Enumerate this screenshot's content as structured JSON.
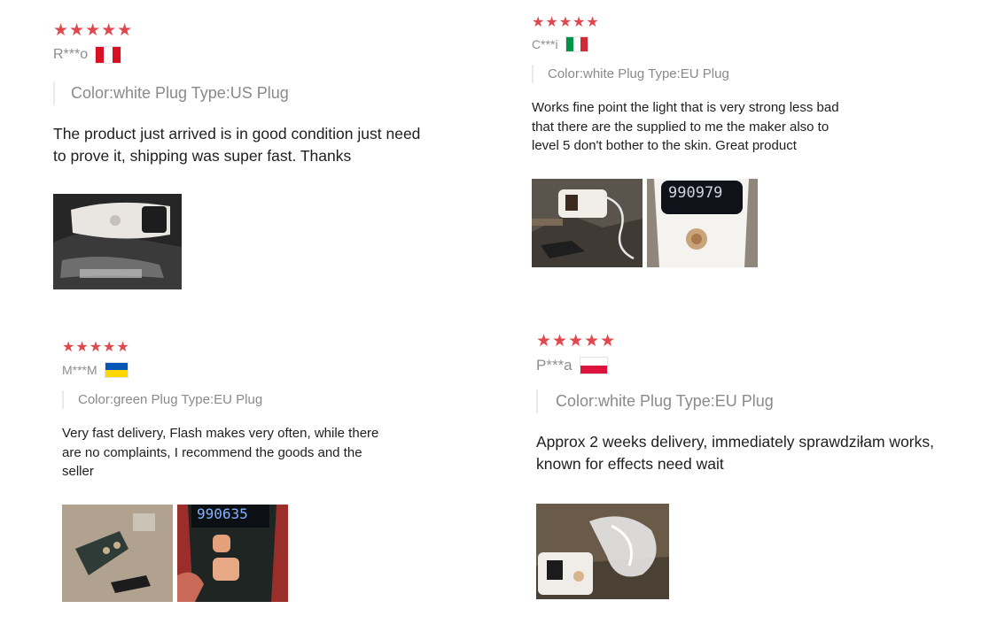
{
  "colors": {
    "star": "#e0484e",
    "muted_text": "#8a8a8a",
    "body_text": "#1e1e1e"
  },
  "reviews": [
    {
      "stars": "★★★★★",
      "reviewer": "R***o",
      "flag": "peru",
      "variant": "Color:white Plug Type:US Plug",
      "text": "The product just arrived is in good condition just need to prove it, shipping was super fast. Thanks",
      "photos": [
        "photo-white-device-in-bag"
      ]
    },
    {
      "stars": "★★★★★",
      "reviewer": "C***i",
      "flag": "italy",
      "variant": "Color:white Plug Type:EU Plug",
      "text": "Works fine point the light that is very strong less bad that there are the supplied to me the maker also to level 5 don't bother to the skin. Great product",
      "photos": [
        "photo-device-with-accessories",
        "photo-device-display"
      ],
      "photo_display_text": "990979"
    },
    {
      "stars": "★★★★★",
      "reviewer": "M***M",
      "flag": "ukraine",
      "variant": "Color:green Plug Type:EU Plug",
      "text": "Very fast delivery, Flash makes very often, while there are no complaints, I recommend the goods and the seller",
      "photos": [
        "photo-green-device-with-goggles",
        "photo-device-in-hand"
      ],
      "photo_display_text": "990635"
    },
    {
      "stars": "★★★★★",
      "reviewer": "P***a",
      "flag": "poland",
      "variant": "Color:white Plug Type:EU Plug",
      "text": "Approx 2 weeks delivery, immediately sprawdziłam works, known for effects need wait",
      "photos": [
        "photo-device-with-charger"
      ]
    }
  ]
}
